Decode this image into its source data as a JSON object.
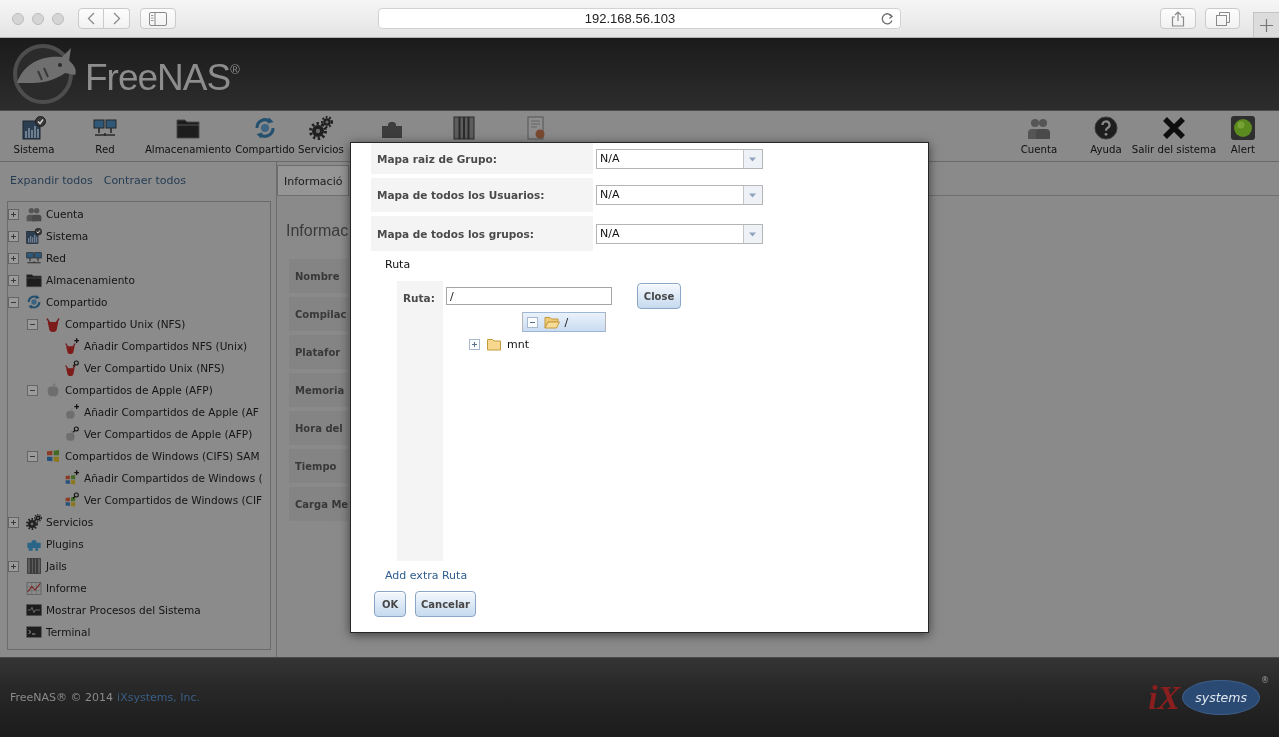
{
  "browser": {
    "url": "192.168.56.103"
  },
  "header": {
    "logo": "FreeNAS$^{®}$"
  },
  "toolbar": {
    "left": [
      {
        "label": "Sistema"
      },
      {
        "label": "Red"
      },
      {
        "label": "Almacenamiento"
      },
      {
        "label": "Compartido"
      },
      {
        "label": "Servicios"
      }
    ],
    "right": [
      {
        "label": "Cuenta"
      },
      {
        "label": "Ayuda"
      },
      {
        "label": "Salir del sistema"
      },
      {
        "label": "Alert"
      }
    ]
  },
  "sidebar": {
    "links": [
      "Expandir todos",
      "Contraer todos"
    ],
    "tree": [
      {
        "label": "Cuenta",
        "expanded": false
      },
      {
        "label": "Sistema",
        "expanded": false
      },
      {
        "label": "Red",
        "expanded": false
      },
      {
        "label": "Almacenamiento",
        "expanded": false
      },
      {
        "label": "Compartido",
        "expanded": true,
        "children": [
          {
            "label": "Compartido Unix (NFS)",
            "expanded": true,
            "children": [
              {
                "label": "Añadir Compartidos NFS (Unix)"
              },
              {
                "label": "Ver Compartido Unix (NFS)"
              }
            ]
          },
          {
            "label": "Compartidos de Apple (AFP)",
            "expanded": true,
            "children": [
              {
                "label": "Añadir Compartidos de Apple (AF"
              },
              {
                "label": "Ver Compartidos de Apple (AFP)"
              }
            ]
          },
          {
            "label": "Compartidos de Windows (CIFS) SAM",
            "expanded": true,
            "children": [
              {
                "label": "Añadir Compartidos de Windows ("
              },
              {
                "label": "Ver Compartidos de Windows (CIF"
              }
            ]
          }
        ]
      },
      {
        "label": "Servicios",
        "expanded": false
      },
      {
        "label": "Plugins"
      },
      {
        "label": "Jails",
        "expanded": false
      },
      {
        "label": "Informe"
      },
      {
        "label": "Mostrar Procesos del Sistema"
      },
      {
        "label": "Terminal"
      }
    ]
  },
  "main": {
    "tabs": [
      {
        "label": "Informació",
        "selected": true
      }
    ],
    "title": "Informac",
    "rows": [
      "Nombre",
      "Compilac",
      "Platafor",
      "Memoria",
      "Hora del",
      "Tiempo",
      "Carga Me"
    ]
  },
  "dialog": {
    "fields": [
      {
        "label": "Mapa raiz de Grupo:",
        "value": "N/A"
      },
      {
        "label": "Mapa de todos los Usuarios:",
        "value": "N/A"
      },
      {
        "label": "Mapa de todos los grupos:",
        "value": "N/A"
      }
    ],
    "section": "Ruta",
    "path": {
      "label": "Ruta:",
      "value": "/"
    },
    "close_button": "Close",
    "folders": [
      {
        "label": "/",
        "expanded": true,
        "selected": true,
        "children": [
          {
            "label": "mnt",
            "expanded": false,
            "selected": false
          }
        ]
      }
    ],
    "add_link": "Add extra Ruta",
    "buttons": [
      "OK",
      "Cancelar"
    ]
  },
  "footer": {
    "text": "FreeNAS® © 2014",
    "link": "iXsystems, Inc.",
    "vendor_logo": {
      "mark": "iX",
      "text": "systems",
      "registered": "®"
    }
  }
}
